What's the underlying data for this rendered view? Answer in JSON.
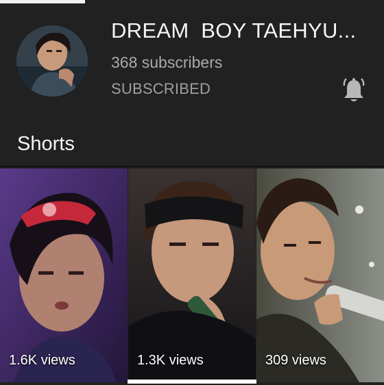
{
  "channel": {
    "name": "DREAM  BOY TAEHYU...",
    "subscribers": "368 subscribers",
    "subscribe_label": "SUBSCRIBED",
    "bell_icon": "bell-filled-icon"
  },
  "shorts": {
    "title": "Shorts",
    "items": [
      {
        "views": "1.6K views",
        "accent": "#4a2a6e"
      },
      {
        "views": "1.3K views",
        "accent": "#2c2c30"
      },
      {
        "views": "309 views",
        "accent": "#3a3d38"
      }
    ]
  },
  "colors": {
    "background": "#212121",
    "primary_text": "#f5f5f5",
    "secondary_text": "#aaaaaa"
  }
}
